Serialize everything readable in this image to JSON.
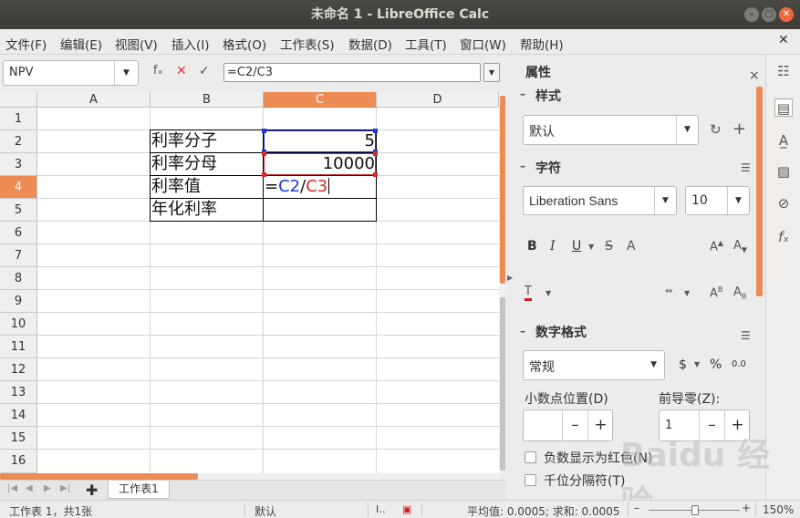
{
  "window": {
    "title": "未命名 1 - LibreOffice Calc",
    "minimize": "–",
    "maximize": "□",
    "close": "✕"
  },
  "menu": [
    "文件(F)",
    "编辑(E)",
    "视图(V)",
    "插入(I)",
    "格式(O)",
    "工作表(S)",
    "数据(D)",
    "工具(T)",
    "窗口(W)",
    "帮助(H)"
  ],
  "formula_bar": {
    "name_box": "NPV",
    "fx_icon": "fₓ",
    "cancel_icon": "✕",
    "accept_icon": "✓",
    "input": "=C2/C3"
  },
  "grid": {
    "columns": [
      "A",
      "B",
      "C",
      "D"
    ],
    "selected_column": "C",
    "rows": [
      "1",
      "2",
      "3",
      "4",
      "5",
      "6",
      "7",
      "8",
      "9",
      "10",
      "11",
      "12",
      "13",
      "14",
      "15",
      "16"
    ],
    "selected_row": "4",
    "cells": {
      "B2": "利率分子",
      "B3": "利率分母",
      "B4": "利率值",
      "B5": "年化利率",
      "C2": "5",
      "C3": "10000",
      "C4_eq": "=",
      "C4_ref1": "C2",
      "C4_slash": "/",
      "C4_ref2": "C3"
    },
    "ref_colors": {
      "C2": "#1a3ad9",
      "C3": "#d92a2a"
    }
  },
  "sheet_tabs": {
    "add": "✚",
    "active": "工作表1",
    "nav": [
      "|◀",
      "◀",
      "▶",
      "▶|"
    ]
  },
  "sidebar": {
    "title": "属性",
    "close": "×",
    "styles": {
      "header": "样式",
      "value": "默认"
    },
    "character": {
      "header": "字符",
      "font": "Liberation Sans",
      "size": "10"
    },
    "number_format": {
      "header": "数字格式",
      "format": "常规",
      "currency": "$",
      "percent": "%",
      "decimal": "0.0",
      "decimal_places_label": "小数点位置(D)",
      "leading_zeros_label": "前导零(Z):",
      "leading_zeros_value": "1",
      "negative_red_label": "负数显示为红色(N)",
      "thousands_sep_label": "千位分隔符(T)"
    }
  },
  "status_bar": {
    "sheet_info": "工作表 1，共1张",
    "page_style": "默认",
    "summary": "平均值: 0.0005; 求和: 0.0005",
    "zoom": "150%",
    "zoom_minus": "–",
    "zoom_plus": "+"
  },
  "watermark": "Baidu 经验"
}
